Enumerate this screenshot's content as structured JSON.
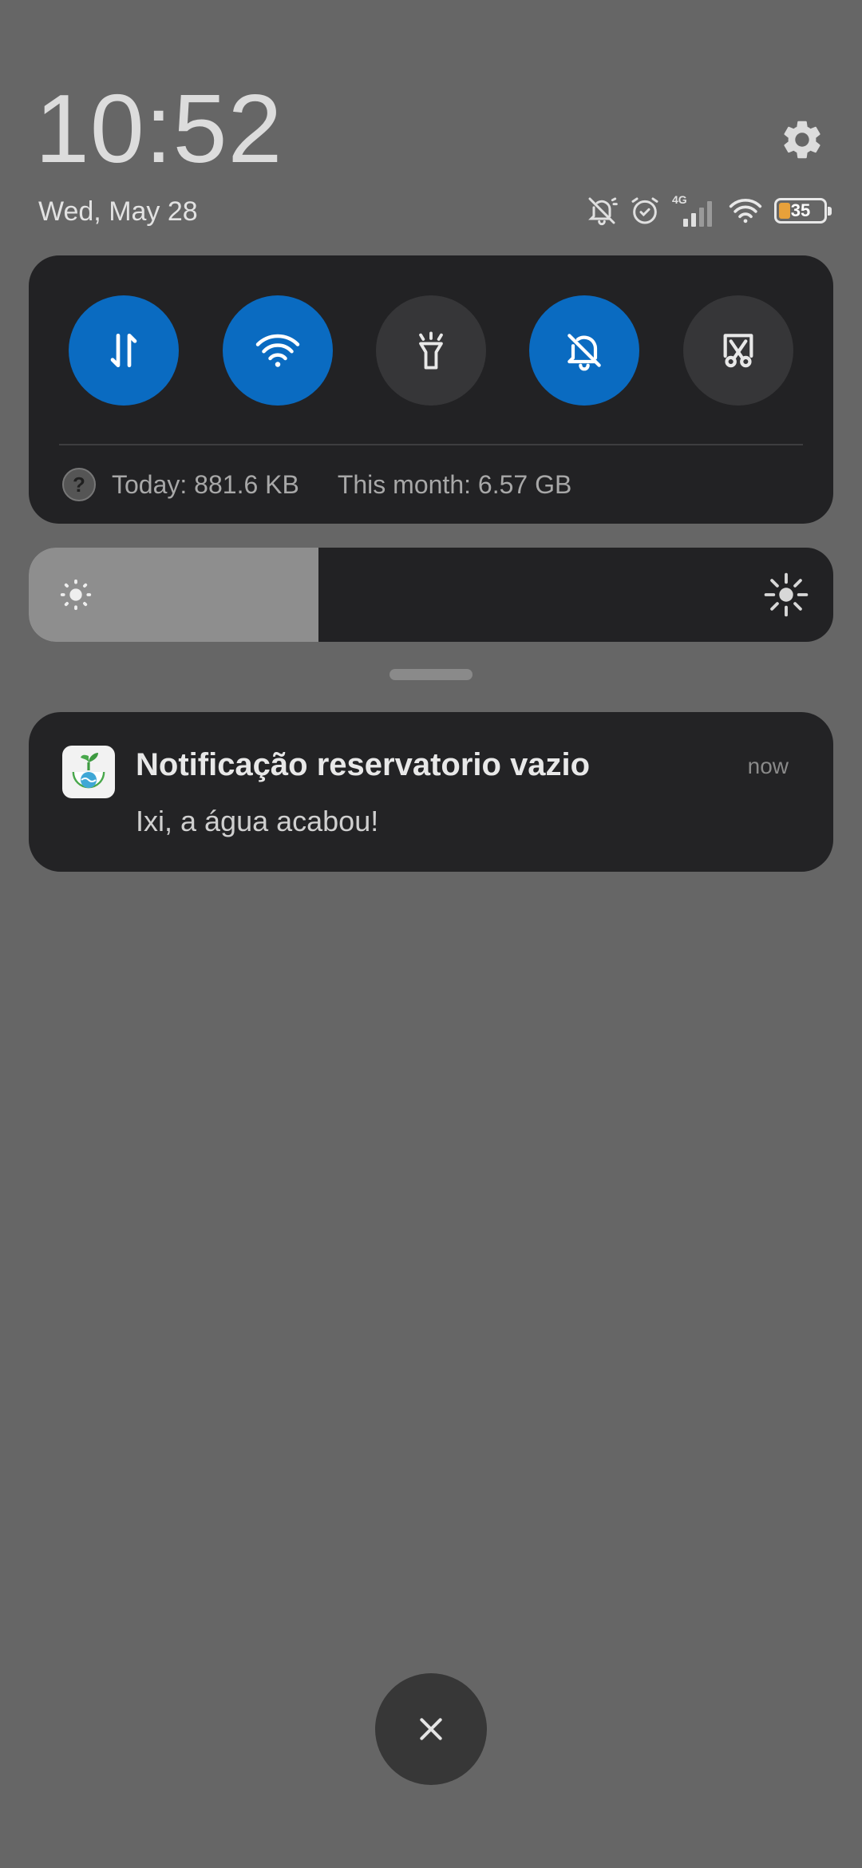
{
  "header": {
    "time": "10:52",
    "date": "Wed, May 28",
    "settings_icon": "gear-icon"
  },
  "status_bar": {
    "icons": [
      "notifications-off-icon",
      "alarm-icon",
      "cellular-4g-icon",
      "wifi-icon",
      "battery-icon"
    ],
    "network_type": "4G",
    "battery_level": "35",
    "battery_color": "#e8a13a"
  },
  "quick_settings": {
    "toggles": [
      {
        "name": "mobile-data",
        "icon": "data-transfer-icon",
        "state": "on"
      },
      {
        "name": "wifi",
        "icon": "wifi-icon",
        "state": "on"
      },
      {
        "name": "flashlight",
        "icon": "flashlight-icon",
        "state": "off"
      },
      {
        "name": "silent",
        "icon": "bell-off-icon",
        "state": "on"
      },
      {
        "name": "screenshot",
        "icon": "scissors-screenshot-icon",
        "state": "off"
      }
    ],
    "accent_color": "#0a6bc1",
    "data_usage": {
      "help_symbol": "?",
      "today": "Today: 881.6 KB",
      "month": "This month: 6.57 GB"
    }
  },
  "brightness": {
    "level_fraction": 0.36,
    "low_icon": "brightness-low-icon",
    "high_icon": "brightness-high-icon"
  },
  "notification": {
    "app_icon": "sprout-drop-icon",
    "title": "Notificação reservatorio vazio",
    "time": "now",
    "body": "Ixi, a água acabou!"
  },
  "close_button": {
    "icon": "close-icon"
  }
}
